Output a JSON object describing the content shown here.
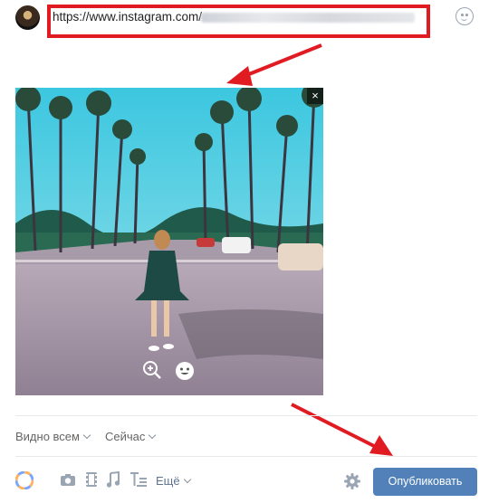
{
  "composer": {
    "url_text": "https://www.instagram.com/",
    "close_glyph": "×"
  },
  "privacy": {
    "visibility_label": "Видно всем",
    "time_label": "Сейчас"
  },
  "toolbar": {
    "more_label": "Ещё",
    "publish_label": "Опубликовать",
    "icons": [
      "color-palette-icon",
      "camera-icon",
      "video-icon",
      "music-icon",
      "text-format-icon",
      "gear-icon"
    ]
  },
  "colors": {
    "accent": "#5181b8",
    "annotation_red": "#e11b22",
    "icon_gray": "#9aa5b3"
  }
}
